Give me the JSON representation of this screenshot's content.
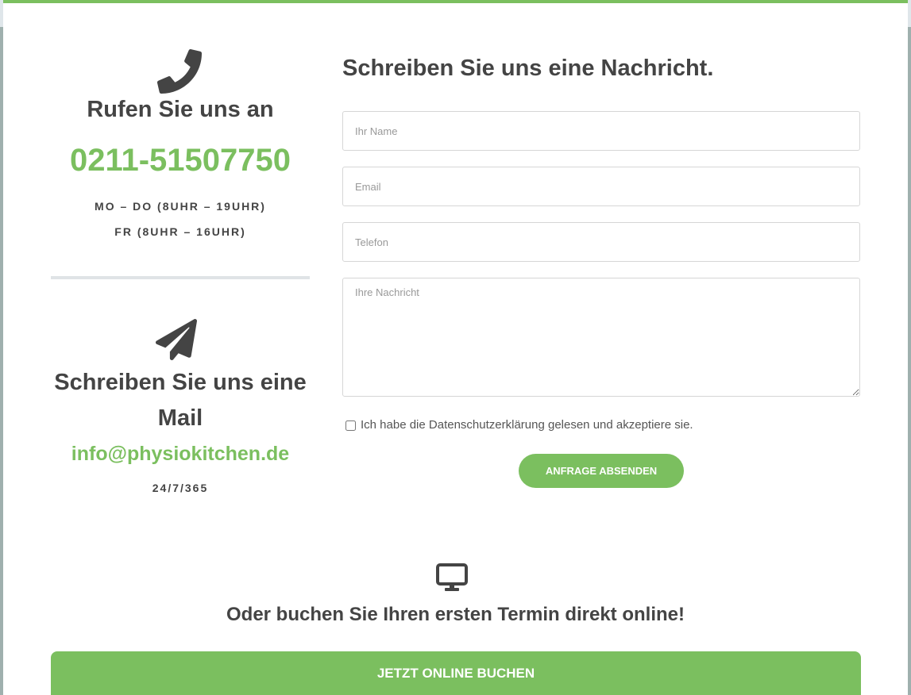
{
  "colors": {
    "accent": "#7bbf5f",
    "text": "#444444",
    "divider": "#dfe3e6"
  },
  "contact_phone": {
    "icon": "phone-icon",
    "title": "Rufen Sie uns an",
    "number": "0211-51507750",
    "hours_line1": "MO – DO (8UHR – 19UHR)",
    "hours_line2": "FR (8UHR – 16UHR)"
  },
  "contact_mail": {
    "icon": "paper-plane-icon",
    "title": "Schreiben Sie uns eine Mail",
    "address": "info@physiokitchen.de",
    "availability": "24/7/365"
  },
  "form": {
    "title": "Schreiben Sie uns eine Nachricht.",
    "name_placeholder": "Ihr Name",
    "email_placeholder": "Email",
    "phone_placeholder": "Telefon",
    "message_placeholder": "Ihre Nachricht",
    "consent_label": "Ich habe die Datenschutzerklärung gelesen und akzeptiere sie.",
    "submit_label": "ANFRAGE ABSENDEN"
  },
  "booking": {
    "icon": "monitor-icon",
    "title": "Oder buchen Sie Ihren ersten Termin direkt online!",
    "button_label": "JETZT ONLINE BUCHEN"
  }
}
